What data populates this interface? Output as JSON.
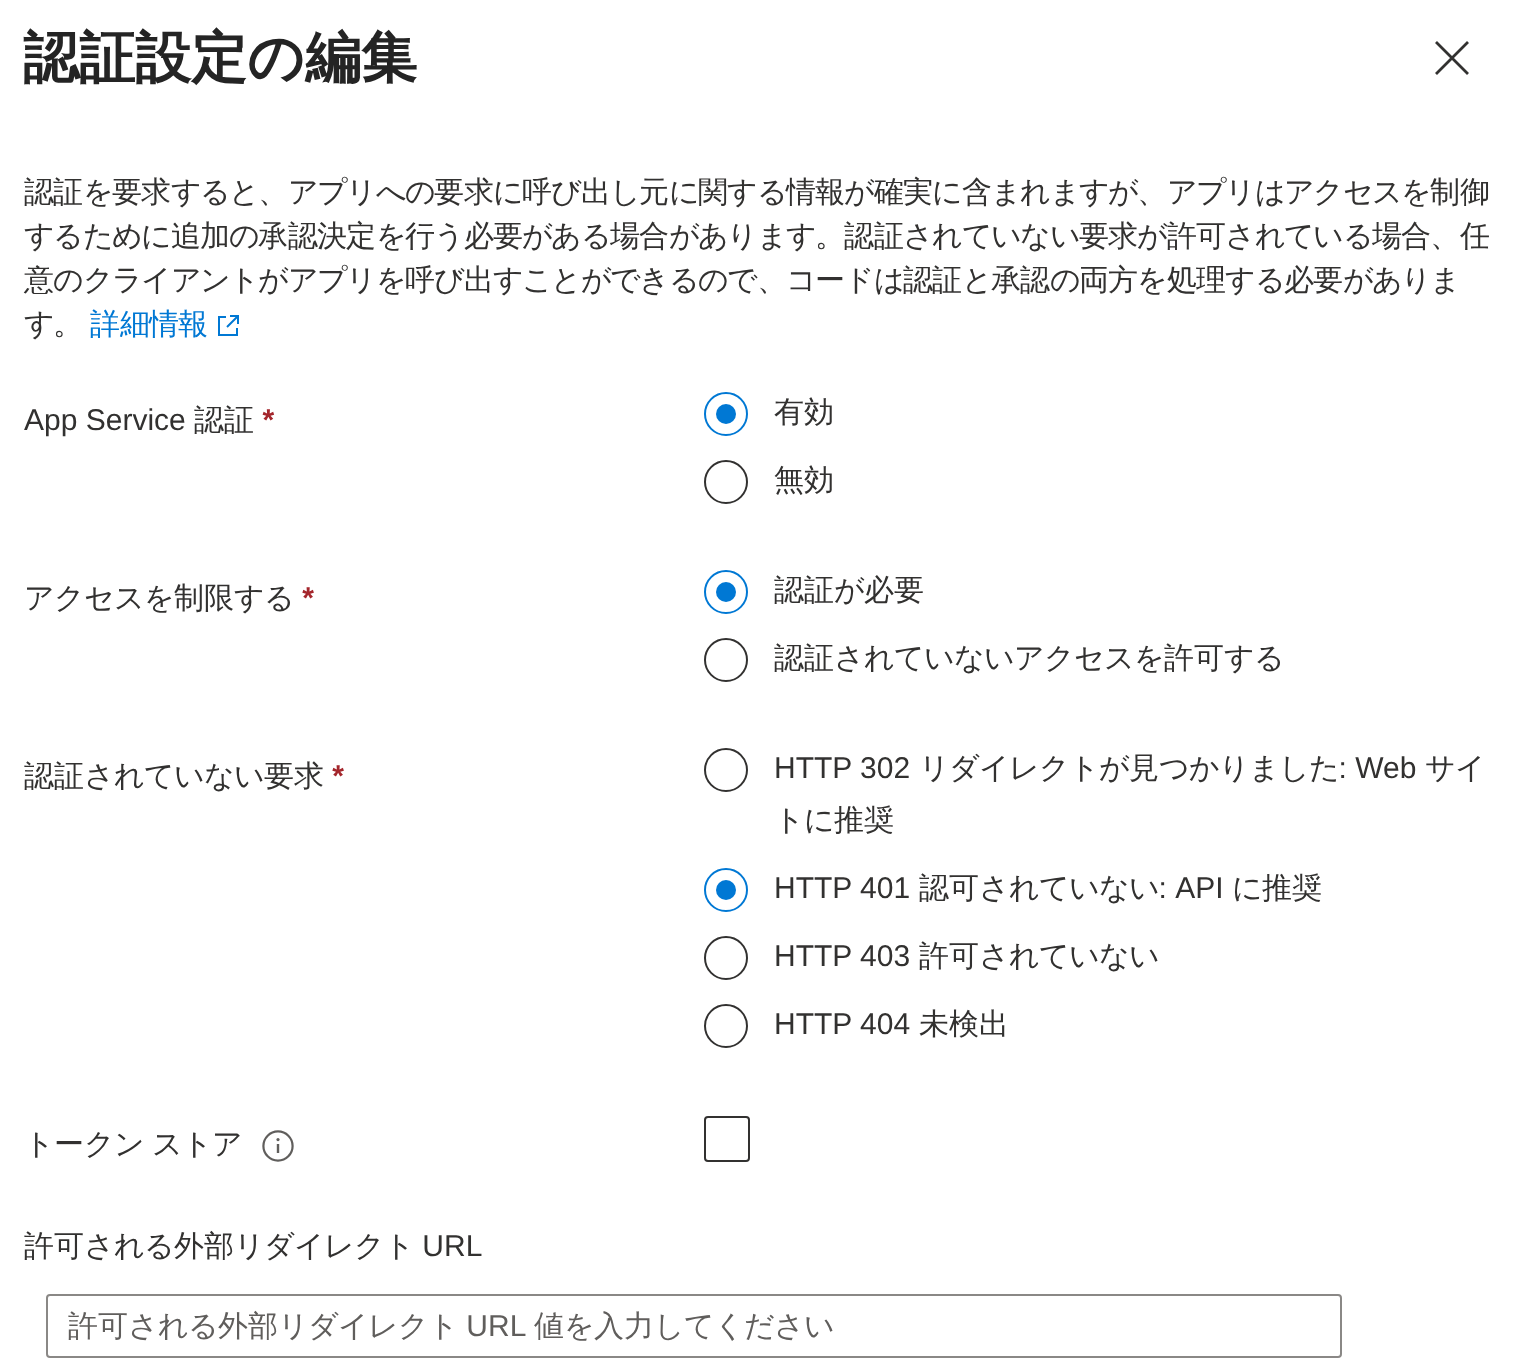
{
  "title": "認証設定の編集",
  "description": {
    "text": "認証を要求すると、アプリへの要求に呼び出し元に関する情報が確実に含まれますが、アプリはアクセスを制御するために追加の承認決定を行う必要がある場合があります。認証されていない要求が許可されている場合、任意のクライアントがアプリを呼び出すことができるので、コードは認証と承認の両方を処理する必要があります。",
    "link": "詳細情報"
  },
  "fields": [
    {
      "kind": "radio",
      "label": "App Service 認証",
      "required_mark": "*",
      "options": [
        {
          "label": "有効",
          "selected": true
        },
        {
          "label": "無効",
          "selected": false
        }
      ]
    },
    {
      "kind": "radio",
      "label": "アクセスを制限する",
      "required_mark": "*",
      "options": [
        {
          "label": "認証が必要",
          "selected": true
        },
        {
          "label": "認証されていないアクセスを許可する",
          "selected": false
        }
      ]
    },
    {
      "kind": "radio",
      "label": "認証されていない要求",
      "required_mark": "*",
      "options": [
        {
          "label": "HTTP 302 リダイレクトが見つかりました: Web サイトに推奨",
          "selected": false
        },
        {
          "label": "HTTP 401 認可されていない: API に推奨",
          "selected": true
        },
        {
          "label": "HTTP 403 許可されていない",
          "selected": false
        },
        {
          "label": "HTTP 404 未検出",
          "selected": false
        }
      ]
    },
    {
      "kind": "checkbox",
      "label": "トークン ストア",
      "info": true,
      "checked": false
    },
    {
      "kind": "text",
      "label": "許可される外部リダイレクト URL",
      "placeholder": "許可される外部リダイレクト URL 値を入力してください"
    }
  ]
}
